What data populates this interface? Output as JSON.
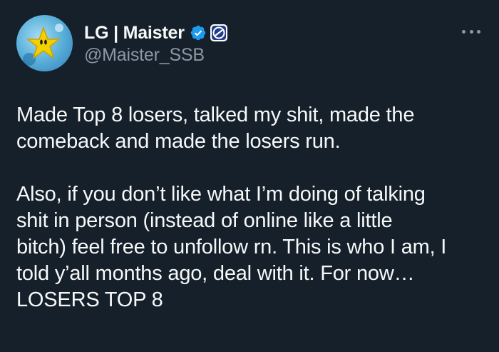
{
  "author": {
    "display_name": "LG | Maister",
    "handle": "@Maister_SSB",
    "avatar_icon": "mario-power-star-avatar",
    "verified_icon": "verified-badge-icon",
    "affiliate_icon": "luminosity-gaming-logo-icon"
  },
  "menu": {
    "icon": "more-options-icon"
  },
  "colors": {
    "background": "#15202b",
    "text": "#f7f9f9",
    "secondary_text": "#8b98a5",
    "verified_blue": "#1d9bf0"
  },
  "tweet": {
    "paragraphs": [
      {
        "lines": [
          "Made Top 8 losers, talked my shit, made the",
          "comeback and made the losers run."
        ]
      },
      {
        "lines": [
          "Also, if you don’t like what I’m doing of talking",
          "shit in person (instead of online like a little",
          "bitch) feel free to unfollow rn. This is who I am, I",
          "told y’all months ago, deal with it. For now…",
          "LOSERS TOP 8"
        ]
      }
    ]
  }
}
